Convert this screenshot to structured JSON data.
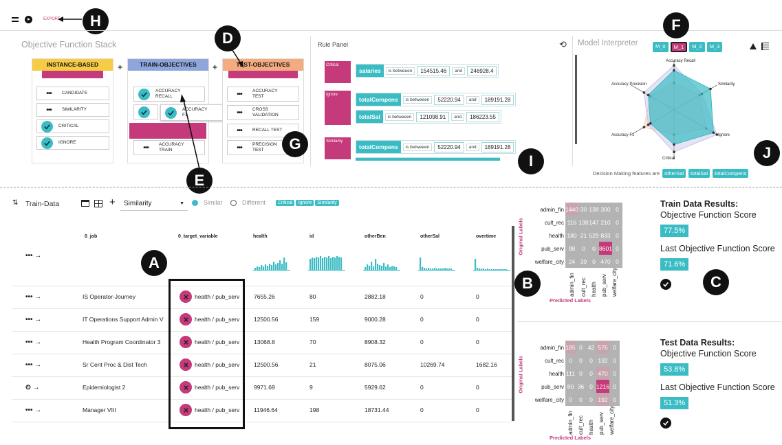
{
  "toolbar": {
    "export_label": "EXPORT"
  },
  "objective_stack": {
    "title": "Objective Function Stack",
    "instance": {
      "header": "INSTANCE-BASED",
      "items": [
        "CANDIDATE",
        "SIMILARITY",
        "CRITICAL",
        "IGNORE"
      ]
    },
    "train": {
      "header": "TRAIN-OBJECTIVES",
      "items": [
        "ACCURACY RECALL",
        "ACCURACY F1",
        "ACCURACY TRAIN"
      ]
    },
    "test": {
      "header": "TEST-OBJECTIVES",
      "items": [
        "ACCURACY TEST",
        "CROSS VALIDATION",
        "RECALL TEST",
        "PRECISION TEST"
      ]
    }
  },
  "rule_panel": {
    "title": "Rule Panel",
    "between": "is betweeen",
    "and": "and",
    "groups": [
      {
        "tag": "Critical",
        "rows": [
          {
            "feature": "salaries",
            "lo": "154515.46",
            "hi": "246928.4"
          }
        ]
      },
      {
        "tag": "Ignore",
        "rows": [
          {
            "feature": "totalCompens",
            "lo": "52220.94",
            "hi": "189191.28"
          },
          {
            "feature": "totalSal",
            "lo": "121098.91",
            "hi": "186223.55"
          }
        ]
      },
      {
        "tag": "Similarity",
        "rows": [
          {
            "feature": "totalCompens",
            "lo": "52220.94",
            "hi": "189191.28"
          }
        ]
      }
    ]
  },
  "interpreter": {
    "title": "Model Interpreter",
    "models": [
      "M_0",
      "M_1",
      "M_2",
      "M_3"
    ],
    "axes": [
      "Accuracy Recall",
      "Similarity",
      "Ignore",
      "Critical",
      "Accuracy F1",
      "Accuracy Precision"
    ],
    "features_label": "Decision Making features are",
    "features": [
      "otherSal",
      "totalSal",
      "totalCompens"
    ]
  },
  "data_toolbar": {
    "title": "Train-Data",
    "select_value": "Similarity",
    "similar": "Similar",
    "different": "Different",
    "tags": [
      "Critical",
      "Ignore",
      "Similarity"
    ]
  },
  "table": {
    "columns": [
      "0_job",
      "0_target_variable",
      "health",
      "id",
      "otherBen",
      "otherSal",
      "overtime"
    ],
    "rows": [
      {
        "job": "IS Operator-Journey",
        "target": "health / pub_serv",
        "health": "7655.26",
        "id": "80",
        "otherBen": "2882.18",
        "otherSal": "0",
        "overtime": "0"
      },
      {
        "job": "IT Operations Support Admin V",
        "target": "health / pub_serv",
        "health": "12500.56",
        "id": "159",
        "otherBen": "9000.28",
        "otherSal": "0",
        "overtime": "0"
      },
      {
        "job": "Health Program Coordinator 3",
        "target": "health / pub_serv",
        "health": "13068.8",
        "id": "70",
        "otherBen": "8908.32",
        "otherSal": "0",
        "overtime": "0"
      },
      {
        "job": "Sr Cent Proc & Dist Tech",
        "target": "health / pub_serv",
        "health": "12500.56",
        "id": "21",
        "otherBen": "8075.06",
        "otherSal": "10269.74",
        "overtime": "1682.16"
      },
      {
        "job": "Epidemiologist 2",
        "target": "health / pub_serv",
        "health": "9971.69",
        "id": "9",
        "otherBen": "5929.62",
        "otherSal": "0",
        "overtime": "0"
      },
      {
        "job": "Manager VIII",
        "target": "health / pub_serv",
        "health": "11946.64",
        "id": "198",
        "otherBen": "18731.44",
        "otherSal": "0",
        "overtime": "0"
      }
    ]
  },
  "confusion": {
    "labels": [
      "admin_fin",
      "cult_rec",
      "health",
      "pub_serv",
      "welfare_city"
    ],
    "ylabel": "Original Labels",
    "xlabel": "Predicted Labels",
    "train": [
      [
        1440,
        30,
        138,
        300,
        0
      ],
      [
        116,
        138,
        147,
        210,
        0
      ],
      [
        180,
        21,
        529,
        833,
        0
      ],
      [
        98,
        0,
        0,
        8601,
        0
      ],
      [
        24,
        39,
        0,
        470,
        0
      ]
    ],
    "test": [
      [
        185,
        0,
        42,
        576,
        0
      ],
      [
        0,
        0,
        0,
        132,
        0
      ],
      [
        111,
        0,
        0,
        470,
        0
      ],
      [
        80,
        36,
        0,
        1216,
        0
      ],
      [
        0,
        0,
        0,
        192,
        0
      ]
    ]
  },
  "results": {
    "train": {
      "title": "Train Data Results:",
      "score_label": "Objective Function Score",
      "score": "77.5%",
      "last_label": "Last Objective Function Score",
      "last": "71.6%"
    },
    "test": {
      "title": "Test Data Results:",
      "score_label": "Objective Function Score",
      "score": "53.8%",
      "last_label": "Last Objective Function Score",
      "last": "51.3%"
    }
  },
  "markers": [
    "A",
    "B",
    "C",
    "D",
    "E",
    "F",
    "G",
    "H",
    "I",
    "J"
  ]
}
